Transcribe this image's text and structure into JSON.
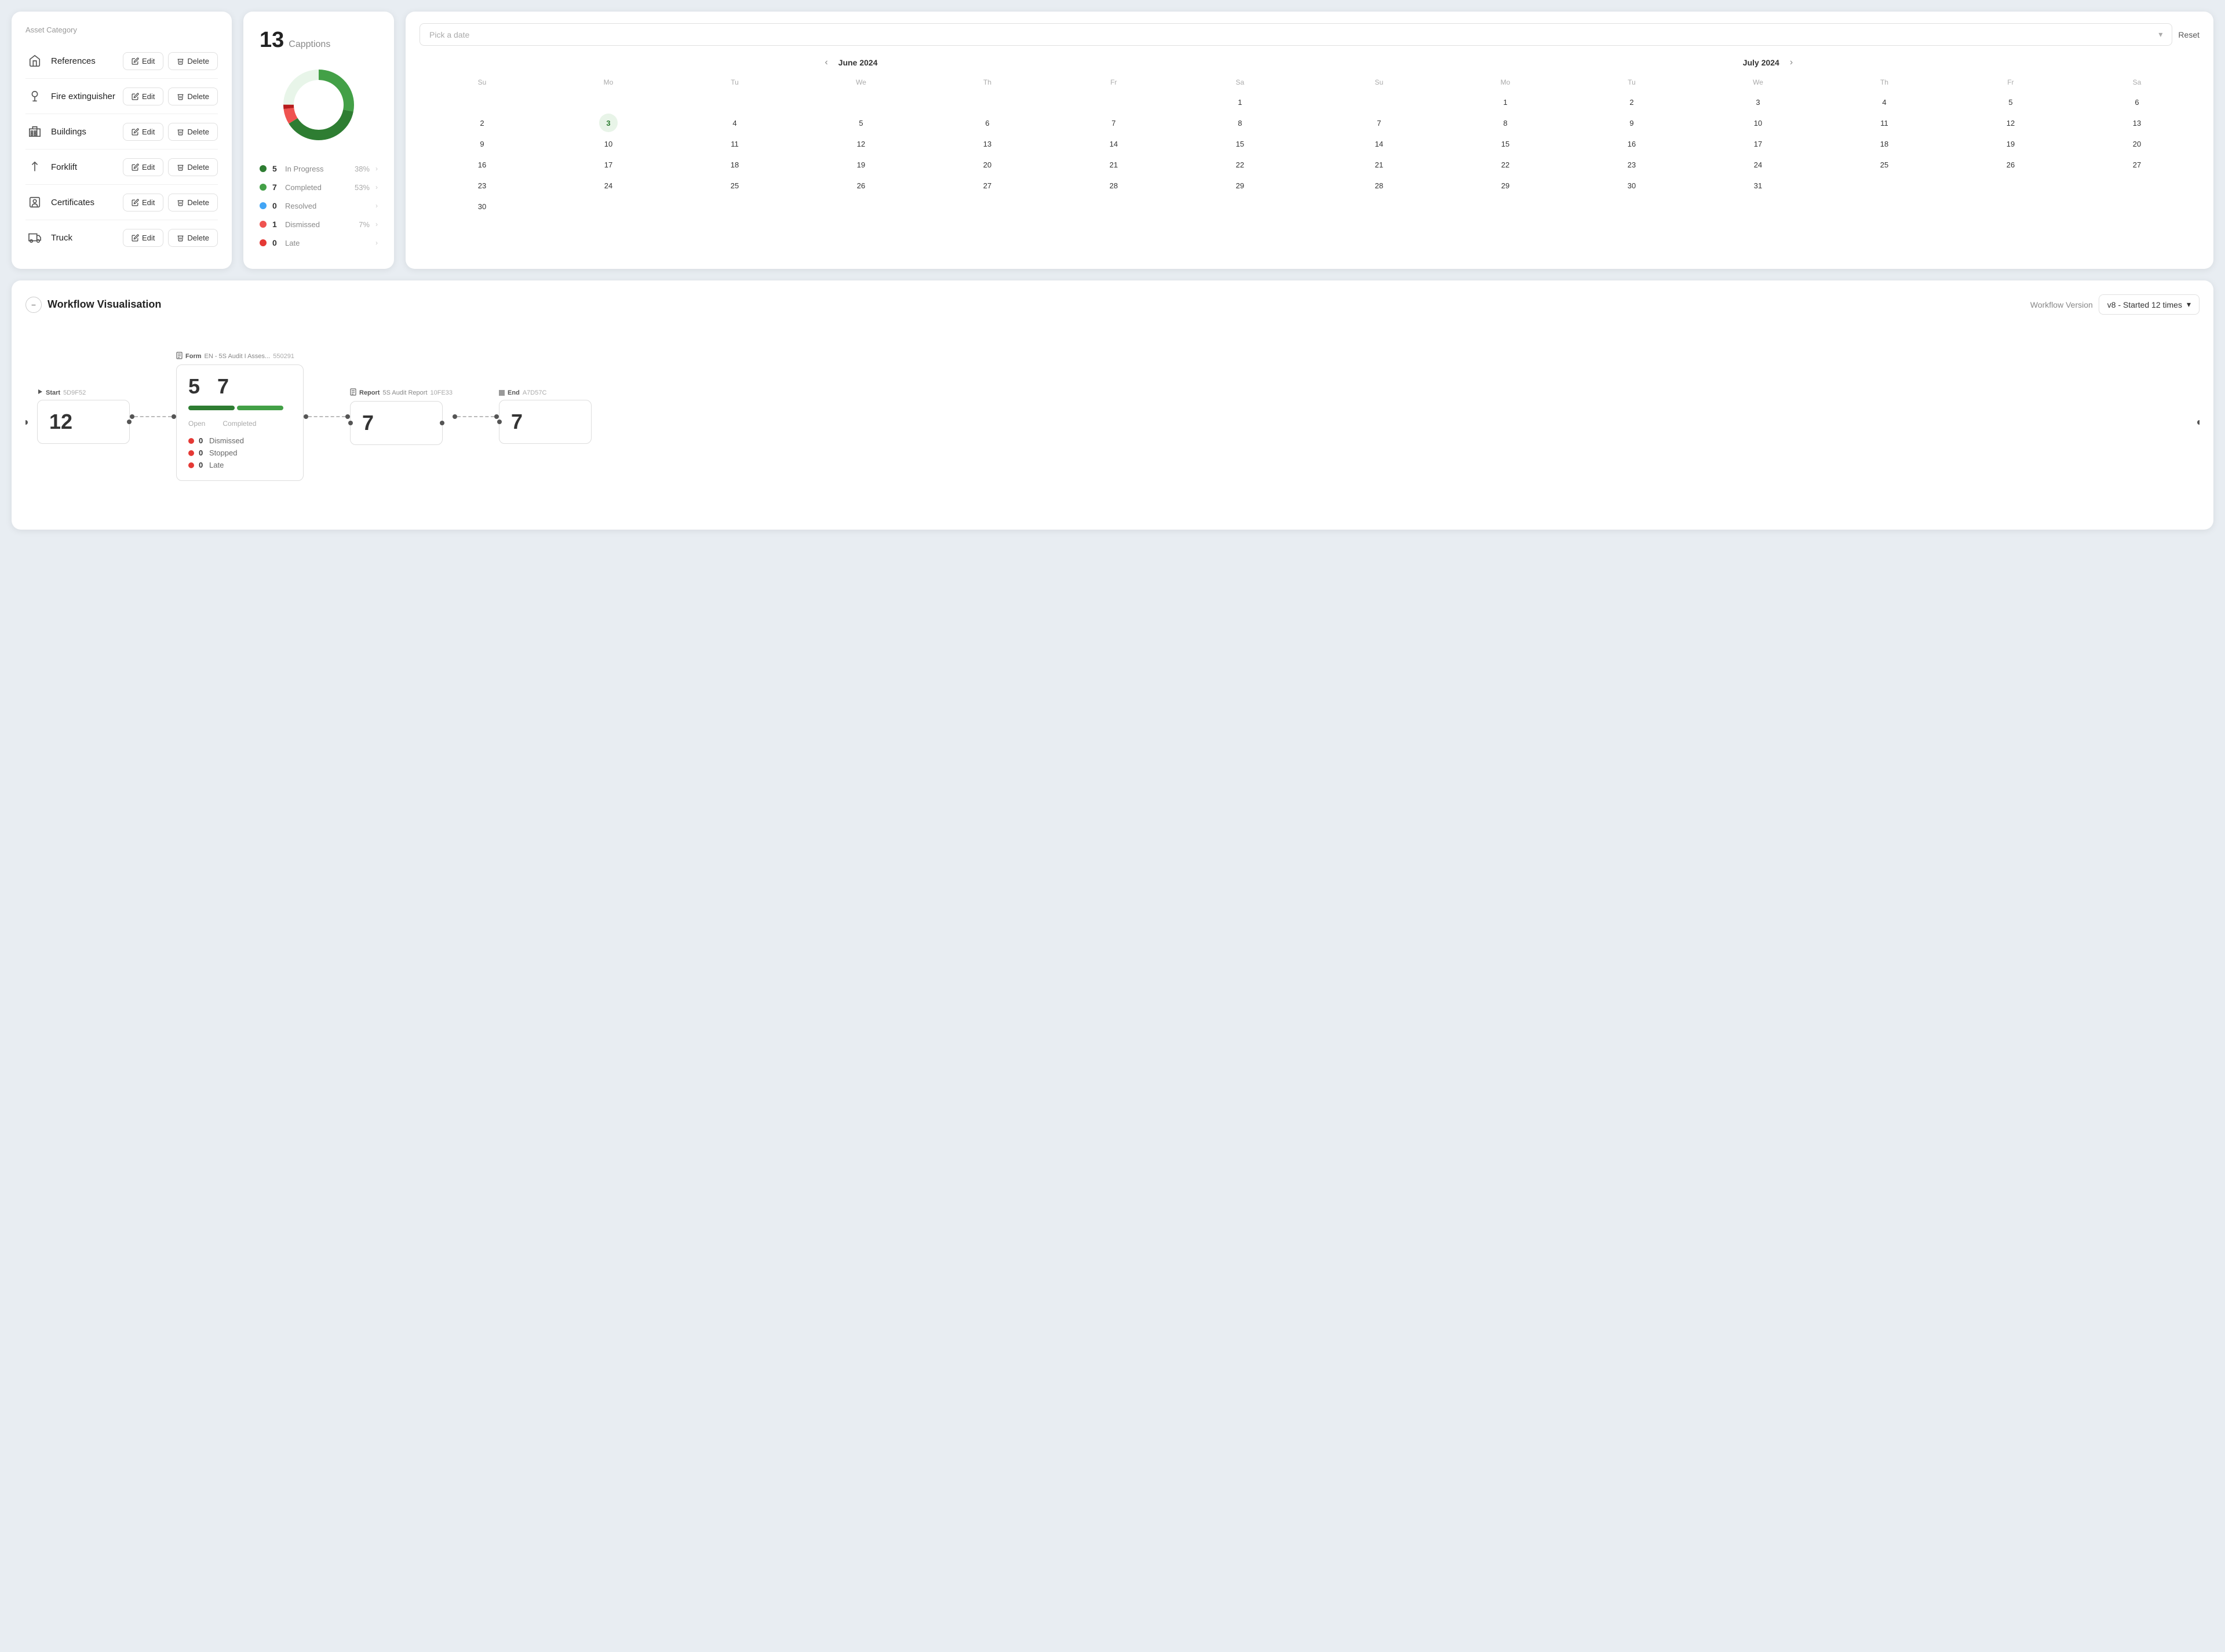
{
  "assetCard": {
    "title": "Asset Category",
    "rows": [
      {
        "id": "references",
        "name": "References",
        "icon": "🏠"
      },
      {
        "id": "fire-extinguisher",
        "name": "Fire extinguisher",
        "icon": "🔥"
      },
      {
        "id": "buildings",
        "name": "Buildings",
        "icon": "🏢"
      },
      {
        "id": "forklift",
        "name": "Forklift",
        "icon": "↑"
      },
      {
        "id": "certificates",
        "name": "Certificates",
        "icon": "🎓"
      },
      {
        "id": "truck",
        "name": "Truck",
        "icon": "🚛"
      }
    ],
    "editLabel": "Edit",
    "deleteLabel": "Delete"
  },
  "captionsCard": {
    "count": "13",
    "label": "Capptions",
    "legend": [
      {
        "color": "#2e7d32",
        "num": "5",
        "text": "In Progress",
        "pct": "38%"
      },
      {
        "color": "#43a047",
        "num": "7",
        "text": "Completed",
        "pct": "53%"
      },
      {
        "color": "#42a5f5",
        "num": "0",
        "text": "Resolved",
        "pct": ""
      },
      {
        "color": "#ef5350",
        "num": "1",
        "text": "Dismissed",
        "pct": "7%"
      },
      {
        "color": "#e53935",
        "num": "0",
        "text": "Late",
        "pct": ""
      }
    ],
    "donut": {
      "inProgress": 38,
      "completed": 53,
      "resolved": 0,
      "dismissed": 7,
      "late": 2
    }
  },
  "calendarCard": {
    "placeholder": "Pick a date",
    "resetLabel": "Reset",
    "months": [
      {
        "title": "June 2024",
        "headers": [
          "Su",
          "Mo",
          "Tu",
          "We",
          "Th",
          "Fr",
          "Sa"
        ],
        "startDay": 6,
        "days": 30,
        "today": 3
      },
      {
        "title": "July 2024",
        "headers": [
          "Su",
          "Mo",
          "Tu",
          "We",
          "Th",
          "Fr",
          "Sa"
        ],
        "startDay": 1,
        "days": 31,
        "today": null
      }
    ]
  },
  "workflowSection": {
    "title": "Workflow Visualisation",
    "versionLabel": "Workflow Version",
    "versionValue": "v8 - Started 12 times",
    "nodes": [
      {
        "type": "start",
        "label": "Start",
        "id": "5D9F52",
        "value": "12"
      },
      {
        "type": "form",
        "label": "Form",
        "name": "EN - 5S Audit I Asses...",
        "id": "550291",
        "open": "5",
        "completed": "7",
        "openLabel": "Open",
        "completedLabel": "Completed",
        "statuses": [
          {
            "label": "Dismissed",
            "value": "0"
          },
          {
            "label": "Stopped",
            "value": "0"
          },
          {
            "label": "Late",
            "value": "0"
          }
        ]
      },
      {
        "type": "report",
        "label": "Report",
        "name": "5S Audit Report",
        "id": "10FE33",
        "value": "7"
      },
      {
        "type": "end",
        "label": "End",
        "id": "A7D57C",
        "value": "7"
      }
    ]
  }
}
